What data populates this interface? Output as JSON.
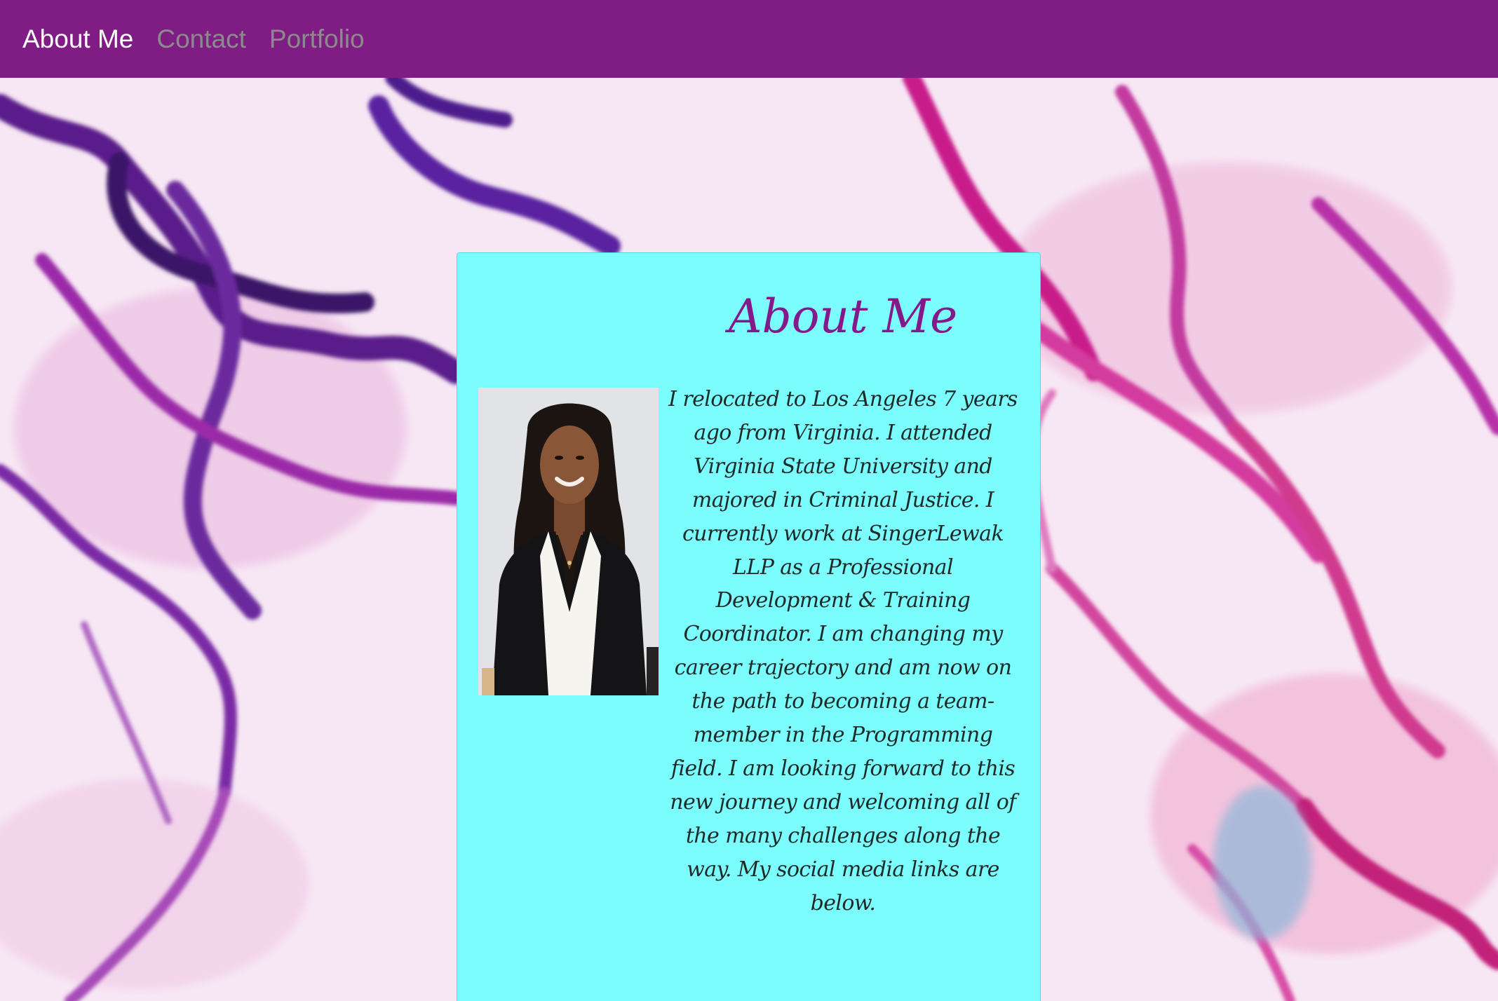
{
  "nav": {
    "items": [
      {
        "label": "About Me",
        "active": true
      },
      {
        "label": "Contact",
        "active": false
      },
      {
        "label": "Portfolio",
        "active": false
      }
    ],
    "background_color": "#7f1d84"
  },
  "card": {
    "title": "About Me",
    "bio": "I relocated to Los Angeles 7 years ago from Virginia. I attended Virginia State University and majored in Criminal Justice. I currently work at SingerLewak LLP as a Professional Development & Training Coordinator. I am changing my career trajectory and am now on the path to becoming a team-member in the Programming field. I am looking forward to this new journey and welcoming all of the many challenges along the way. My social media links are below.",
    "background_color": "#7cfdfd",
    "title_color": "#85198a"
  },
  "photo": {
    "icon": "profile-photo"
  }
}
